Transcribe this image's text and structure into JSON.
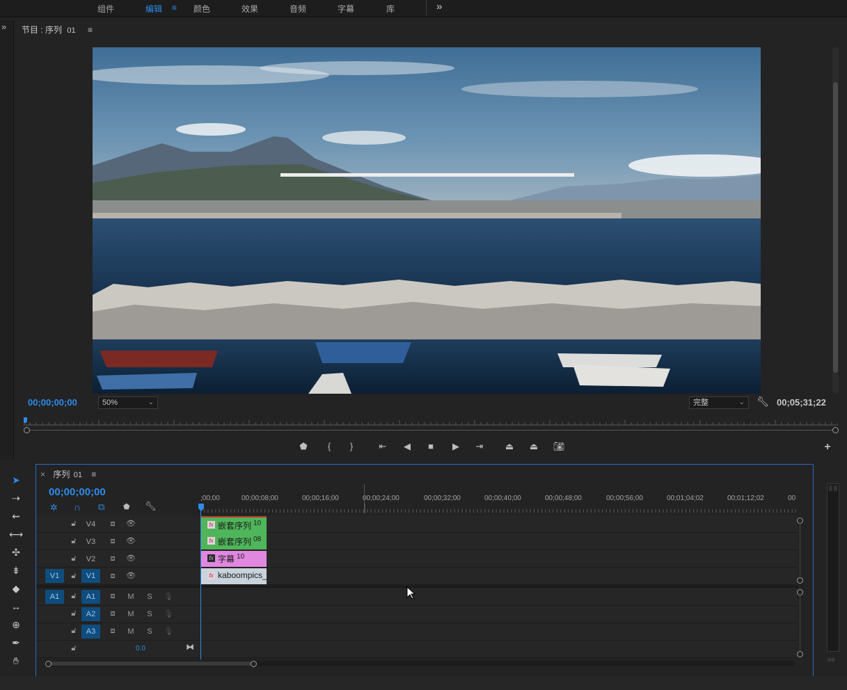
{
  "workspace_tabs": [
    {
      "label": "组件"
    },
    {
      "label": "编辑",
      "menu": "≡"
    },
    {
      "label": "颜色"
    },
    {
      "label": "效果"
    },
    {
      "label": "音频"
    },
    {
      "label": "字幕"
    },
    {
      "label": "库"
    }
  ],
  "overflow": "»",
  "program_monitor": {
    "title": "节目 : 序列",
    "sequence_number": "01",
    "menu": "≡",
    "current_timecode": "00;00;00;00",
    "zoom": "50%",
    "quality": "完整",
    "duration": "00;05;31;22"
  },
  "timeline": {
    "close": "×",
    "tab_title": "序列",
    "tab_number": "01",
    "menu": "≡",
    "timecode": "00;00;00;00",
    "ruler_labels": [
      ";00;00",
      "00;00;08;00",
      "00;00;16;00",
      "00;00;24;00",
      "00;00;32;00",
      "00;00;40;00",
      "00;00;48;00",
      "00;00;56;00",
      "00;01;04;02",
      "00;01;12;02",
      "00"
    ],
    "video_tracks": [
      {
        "name": "V4",
        "source": ""
      },
      {
        "name": "V3",
        "source": ""
      },
      {
        "name": "V2",
        "source": ""
      },
      {
        "name": "V1",
        "source": "V1"
      }
    ],
    "audio_tracks": [
      {
        "name": "A1",
        "source": "A1",
        "mute": "M",
        "solo": "S"
      },
      {
        "name": "A2",
        "source": "",
        "mute": "M",
        "solo": "S"
      },
      {
        "name": "A3",
        "source": "",
        "mute": "M",
        "solo": "S"
      }
    ],
    "master_volume": "0.0",
    "clips": [
      {
        "track": "V4",
        "label": "嵌套序列",
        "index": "10",
        "color": "#4fb55a"
      },
      {
        "track": "V3",
        "label": "嵌套序列",
        "index": "08",
        "color": "#4fb55a"
      },
      {
        "track": "V2",
        "label": "字幕",
        "index": "10",
        "color": "#e087e0"
      },
      {
        "track": "V1",
        "label": "kaboompics_",
        "index": "",
        "color": "#b8c8d8"
      }
    ],
    "fx_badge": "fx",
    "mute_label": "M",
    "solo_label": "S"
  },
  "meter_labels": "○○"
}
